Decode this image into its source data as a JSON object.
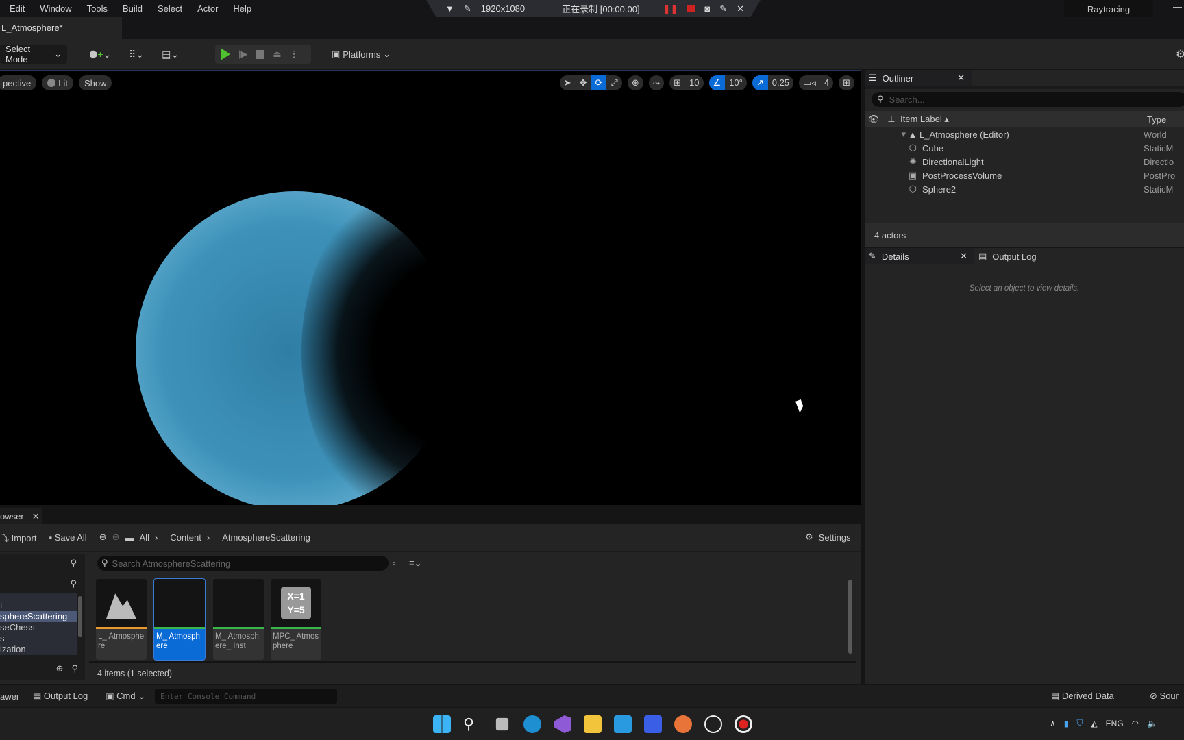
{
  "menu": [
    "Edit",
    "Window",
    "Tools",
    "Build",
    "Select",
    "Actor",
    "Help"
  ],
  "recorder": {
    "resolution": "1920x1080",
    "status": "正在录制 [00:00:00]"
  },
  "raytracing": "Raytracing",
  "map_tab": "L_Atmosphere*",
  "toolbar": {
    "select_mode": "Select Mode",
    "platforms": "Platforms"
  },
  "viewport": {
    "perspective": "pective",
    "lit": "Lit",
    "show": "Show",
    "grid": "10",
    "angle": "10°",
    "scale": "0.25",
    "camera_speed": "4"
  },
  "outliner": {
    "title": "Outliner",
    "search_placeholder": "Search...",
    "col_label": "Item Label",
    "col_type": "Type",
    "world": {
      "label": "L_Atmosphere (Editor)",
      "type": "World"
    },
    "items": [
      {
        "label": "Cube",
        "type": "StaticM",
        "icon": "static-mesh-icon"
      },
      {
        "label": "DirectionalLight",
        "type": "Directio",
        "icon": "directional-light-icon"
      },
      {
        "label": "PostProcessVolume",
        "type": "PostPro",
        "icon": "post-process-icon"
      },
      {
        "label": "Sphere2",
        "type": "StaticM",
        "icon": "static-mesh-icon"
      }
    ],
    "count": "4 actors"
  },
  "details": {
    "title": "Details",
    "output_log": "Output Log",
    "empty": "Select an object to view details."
  },
  "content_browser": {
    "tab": "owser",
    "import": "Import",
    "save_all": "Save All",
    "path": [
      "All",
      "Content",
      "AtmosphereScattering"
    ],
    "settings": "Settings",
    "search_placeholder": "Search AtmosphereScattering",
    "folders": [
      "t",
      "sphereScattering",
      "seChess",
      "s",
      "ization"
    ],
    "assets": [
      {
        "label": "L_ Atmosphere",
        "color": "#e89a2c"
      },
      {
        "label": "M_ Atmosphere",
        "color": "#39b54a"
      },
      {
        "label": "M_ Atmosphere_ Inst",
        "color": "#39b54a"
      },
      {
        "label": "MPC_ Atmosphere",
        "color": "#39b54a"
      }
    ],
    "mpc_icon_text": "X=1 Y=5",
    "status": "4 items (1 selected)"
  },
  "statusbar": {
    "drawer": "awer",
    "output_log": "Output Log",
    "cmd": "Cmd",
    "console_placeholder": "Enter Console Command",
    "derived_data": "Derived Data",
    "source": "Sour"
  },
  "taskbar": {
    "lang": "ENG"
  },
  "colors": {
    "accent": "#0a6ad6",
    "play": "#4fc030"
  }
}
